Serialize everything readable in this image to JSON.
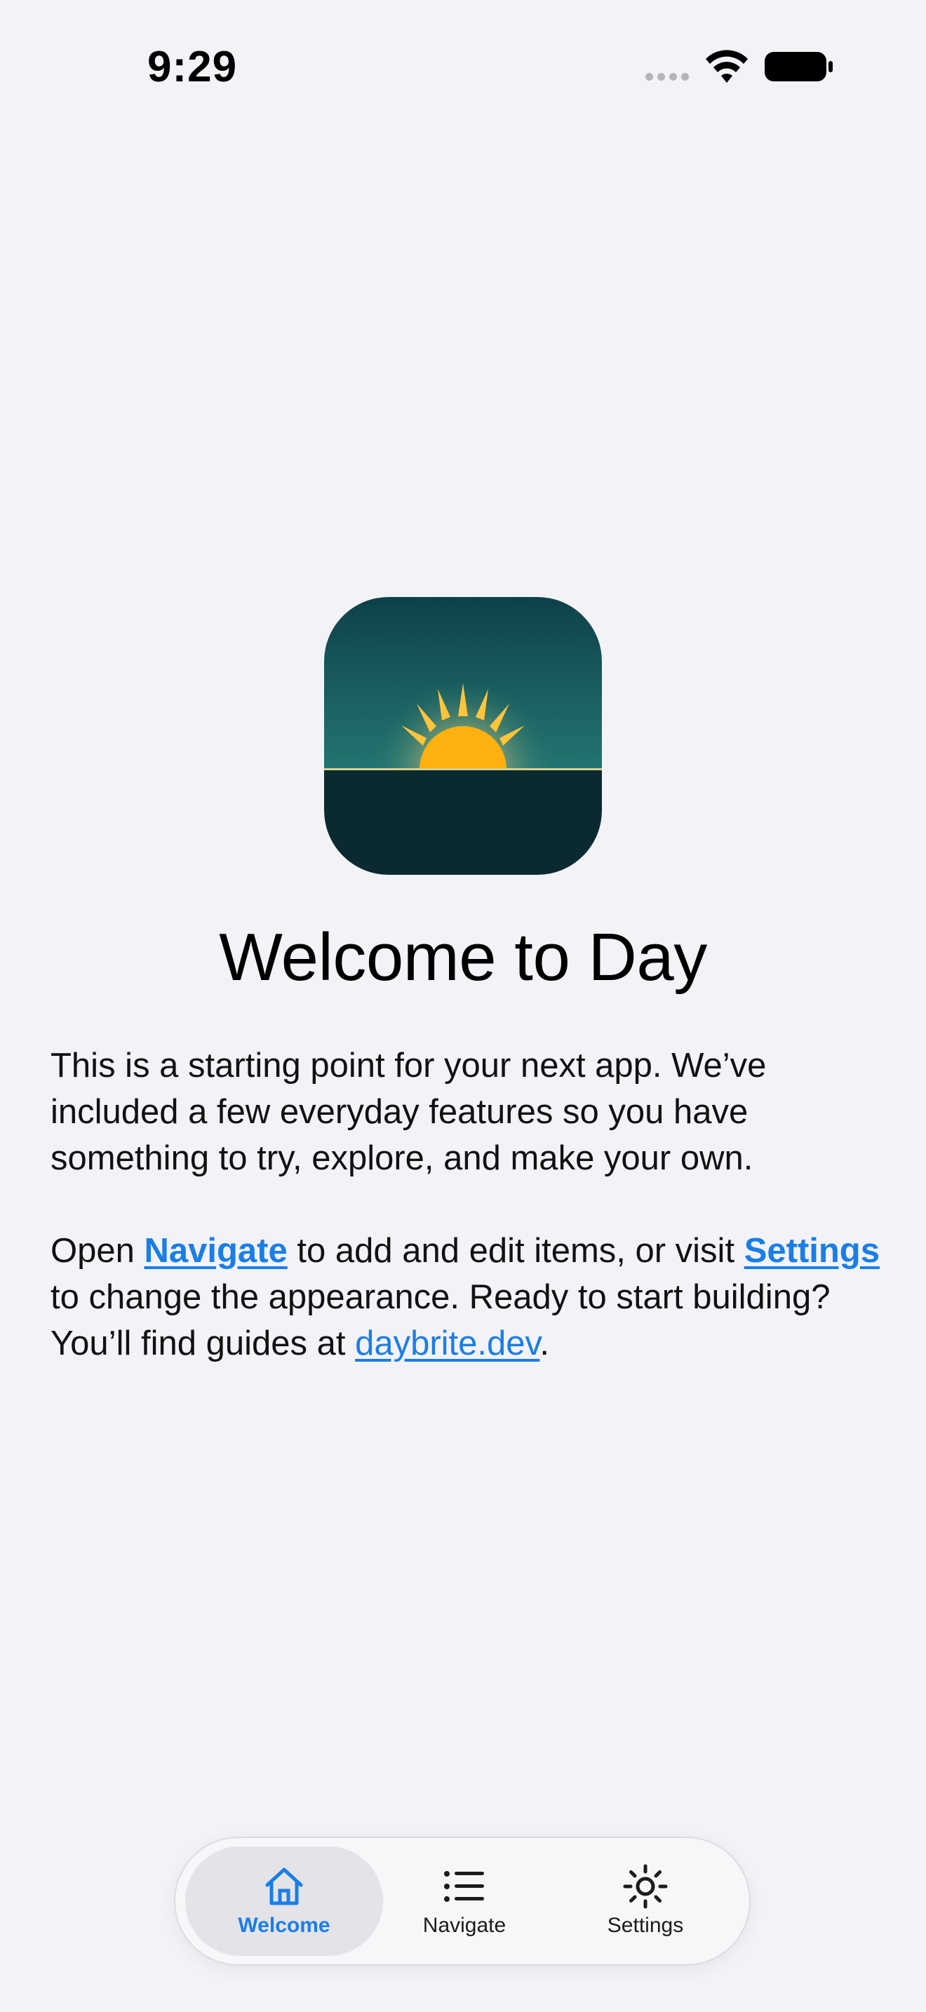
{
  "status_bar": {
    "time": "9:29",
    "icons": [
      "cellular-signal-icon",
      "wifi-icon",
      "battery-icon"
    ]
  },
  "welcome": {
    "app_icon": "sunrise-app-icon",
    "title": "Welcome to Day",
    "paragraph1": "This is a starting point for your next app. We’ve included a few everyday features so you have something to try, explore, and make your own.",
    "p2_open": "Open ",
    "p2_navigate_link": "Navigate",
    "p2_middle": " to add and edit items, or visit ",
    "p2_settings_link": "Settings",
    "p2_after_settings": " to change the appearance. Ready to start building? You’ll find guides at ",
    "p2_site_link": "daybrite.dev",
    "p2_end": "."
  },
  "tab_bar": {
    "selected": "Welcome",
    "tabs": [
      {
        "label": "Welcome",
        "icon": "house-icon"
      },
      {
        "label": "Navigate",
        "icon": "list-icon"
      },
      {
        "label": "Settings",
        "icon": "sun-gear-icon"
      }
    ]
  },
  "colors": {
    "background": "#f2f2f7",
    "accent": "#1a7ee6",
    "icon_sky": "#1e6a6a",
    "icon_ground": "#0a2a30",
    "icon_sun": "#ffb20f"
  }
}
